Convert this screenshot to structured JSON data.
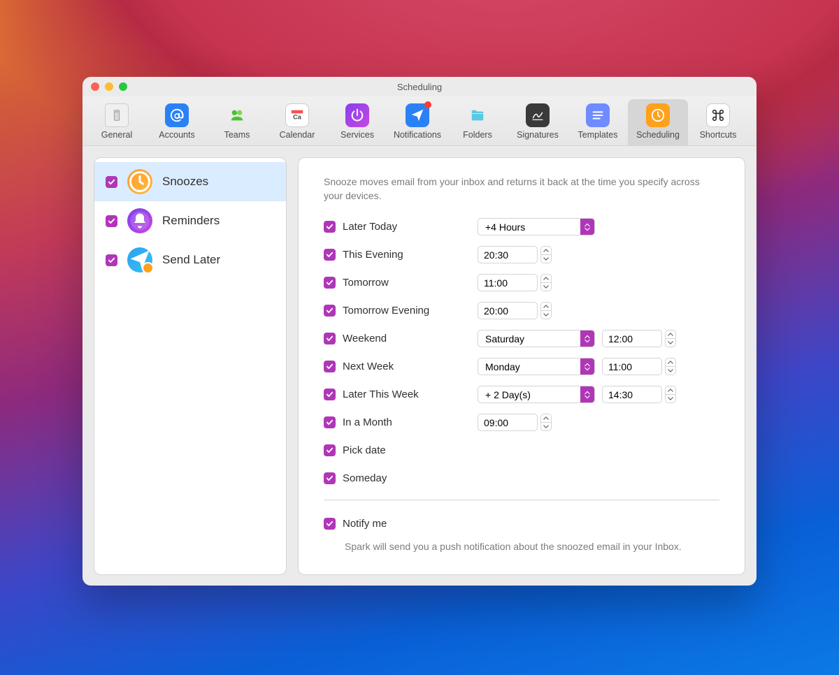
{
  "window": {
    "title": "Scheduling"
  },
  "colors": {
    "accent": "#b036b8"
  },
  "toolbar": [
    {
      "id": "general",
      "label": "General"
    },
    {
      "id": "accounts",
      "label": "Accounts"
    },
    {
      "id": "teams",
      "label": "Teams"
    },
    {
      "id": "calendar",
      "label": "Calendar"
    },
    {
      "id": "services",
      "label": "Services"
    },
    {
      "id": "notifications",
      "label": "Notifications",
      "badge": true
    },
    {
      "id": "folders",
      "label": "Folders"
    },
    {
      "id": "signatures",
      "label": "Signatures"
    },
    {
      "id": "templates",
      "label": "Templates"
    },
    {
      "id": "scheduling",
      "label": "Scheduling",
      "selected": true
    },
    {
      "id": "shortcuts",
      "label": "Shortcuts"
    }
  ],
  "sidebar": {
    "items": [
      {
        "id": "snoozes",
        "label": "Snoozes",
        "enabled": true,
        "selected": true
      },
      {
        "id": "reminders",
        "label": "Reminders",
        "enabled": true
      },
      {
        "id": "sendlater",
        "label": "Send Later",
        "enabled": true
      }
    ]
  },
  "snoozes": {
    "description": "Snooze moves email from your inbox and returns it back at the time you specify across your devices.",
    "rows": {
      "later_today": {
        "label": "Later Today",
        "enabled": true,
        "offset": "+4 Hours"
      },
      "this_evening": {
        "label": "This Evening",
        "enabled": true,
        "time": "20:30"
      },
      "tomorrow": {
        "label": "Tomorrow",
        "enabled": true,
        "time": "11:00"
      },
      "tomorrow_evening": {
        "label": "Tomorrow Evening",
        "enabled": true,
        "time": "20:00"
      },
      "weekend": {
        "label": "Weekend",
        "enabled": true,
        "day": "Saturday",
        "time": "12:00"
      },
      "next_week": {
        "label": "Next Week",
        "enabled": true,
        "day": "Monday",
        "time": "11:00"
      },
      "later_this_week": {
        "label": "Later This Week",
        "enabled": true,
        "offset": "+ 2 Day(s)",
        "time": "14:30"
      },
      "in_a_month": {
        "label": "In a Month",
        "enabled": true,
        "time": "09:00"
      },
      "pick_date": {
        "label": "Pick date",
        "enabled": true
      },
      "someday": {
        "label": "Someday",
        "enabled": true
      }
    },
    "notify": {
      "label": "Notify me",
      "enabled": true,
      "hint": "Spark will send you a push notification about the snoozed email in your Inbox."
    }
  }
}
